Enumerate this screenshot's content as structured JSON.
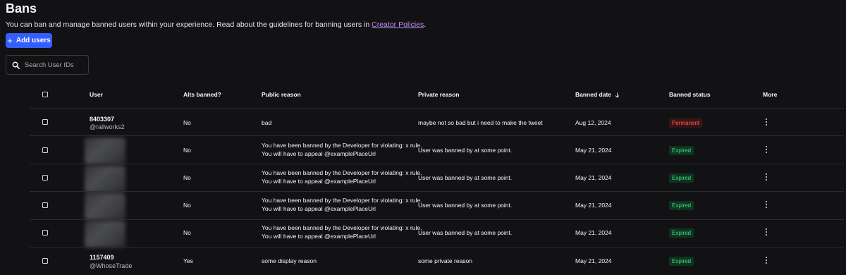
{
  "header": {
    "title": "Bans",
    "description": "You can ban and manage banned users within your experience. Read about the guidelines for banning users in ",
    "link_text": "Creator Policies",
    "description_end": "."
  },
  "actions": {
    "add_label": "Add users",
    "add_icon": "plus-icon"
  },
  "search": {
    "placeholder": "Search User IDs",
    "icon": "search-icon"
  },
  "table": {
    "columns": [
      "User",
      "Alts banned?",
      "Public reason",
      "Private reason",
      "Banned date",
      "Banned status",
      "More"
    ],
    "sort_icon": "arrow-down-icon",
    "rows": [
      {
        "user_id": "8403307",
        "username": "@railworks2",
        "alts": "No",
        "public_reason": [
          "bad"
        ],
        "private_reason": "maybe not so bad but i need to make the tweet",
        "date": "Aug 12, 2024",
        "status": "Permanent"
      },
      {
        "user_id": "",
        "username": "",
        "alts": "No",
        "public_reason": [
          "You have been banned by the Developer for violating: x rule.",
          "You will have to appeal @examplePlaceUrl"
        ],
        "private_reason": "User was banned by at some point.",
        "date": "May 21, 2024",
        "status": "Expired"
      },
      {
        "user_id": "",
        "username": "",
        "alts": "No",
        "public_reason": [
          "You have been banned by the Developer for violating: x rule.",
          "You will have to appeal @examplePlaceUrl"
        ],
        "private_reason": "User was banned by at some point.",
        "date": "May 21, 2024",
        "status": "Expired"
      },
      {
        "user_id": "",
        "username": "",
        "alts": "No",
        "public_reason": [
          "You have been banned by the Developer for violating: x rule.",
          "You will have to appeal @examplePlaceUrl"
        ],
        "private_reason": "User was banned by at some point.",
        "date": "May 21, 2024",
        "status": "Expired"
      },
      {
        "user_id": "",
        "username": "",
        "alts": "No",
        "public_reason": [
          "You have been banned by the Developer for violating: x rule.",
          "You will have to appeal @examplePlaceUrl"
        ],
        "private_reason": "User was banned by at some point.",
        "date": "May 21, 2024",
        "status": "Expired"
      },
      {
        "user_id": "1157409",
        "username": "@WhoseTrade",
        "alts": "Yes",
        "public_reason": [
          "some display reason"
        ],
        "private_reason": "some private reason",
        "date": "May 21, 2024",
        "status": "Expired"
      }
    ]
  },
  "colors": {
    "background": "#121215",
    "accent": "#335fff",
    "link": "#c28cf5",
    "permanent": "#ff5a5a",
    "expired": "#3ee07d"
  }
}
